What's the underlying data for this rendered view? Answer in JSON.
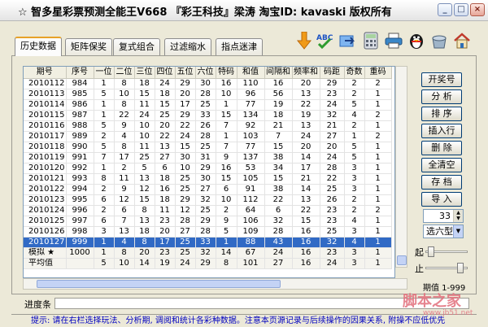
{
  "window": {
    "title": "☆ 智多星彩票预测全能王V668 『彩王科技』梁涛 淘宝ID: kavaski 版权所有",
    "controls": {
      "minimize": "_",
      "restore": "□",
      "close": "×"
    }
  },
  "tabs": [
    {
      "label": "历史数据",
      "active": true
    },
    {
      "label": "矩阵保奖",
      "active": false
    },
    {
      "label": "复式组合",
      "active": false
    },
    {
      "label": "过滤缩水",
      "active": false
    },
    {
      "label": "指点迷津",
      "active": false
    }
  ],
  "toolbar_icons": [
    "download-arrow-icon",
    "spellcheck-abc-icon",
    "export-icon",
    "calculator-icon",
    "printer-icon",
    "qq-penguin-icon",
    "recycle-icon",
    "home-icon"
  ],
  "grid": {
    "columns": [
      "期号",
      "序号",
      "一位",
      "二位",
      "三位",
      "四位",
      "五位",
      "六位",
      "特码",
      "和值",
      "间隔和",
      "频率和",
      "码距",
      "奇数",
      "重码"
    ],
    "rows": [
      [
        "2010112",
        "984",
        "1",
        "8",
        "18",
        "24",
        "29",
        "30",
        "16",
        "110",
        "16",
        "20",
        "29",
        "2",
        "2"
      ],
      [
        "2010113",
        "985",
        "5",
        "10",
        "15",
        "18",
        "20",
        "28",
        "10",
        "96",
        "56",
        "13",
        "23",
        "2",
        "1"
      ],
      [
        "2010114",
        "986",
        "1",
        "8",
        "11",
        "15",
        "17",
        "25",
        "1",
        "77",
        "19",
        "22",
        "24",
        "5",
        "1"
      ],
      [
        "2010115",
        "987",
        "1",
        "22",
        "24",
        "25",
        "29",
        "33",
        "15",
        "134",
        "18",
        "19",
        "32",
        "4",
        "2"
      ],
      [
        "2010116",
        "988",
        "5",
        "9",
        "10",
        "20",
        "22",
        "26",
        "7",
        "92",
        "21",
        "13",
        "21",
        "2",
        "1"
      ],
      [
        "2010117",
        "989",
        "2",
        "4",
        "10",
        "22",
        "24",
        "28",
        "1",
        "103",
        "7",
        "24",
        "27",
        "1",
        "2"
      ],
      [
        "2010118",
        "990",
        "5",
        "8",
        "11",
        "13",
        "15",
        "25",
        "7",
        "77",
        "15",
        "20",
        "20",
        "5",
        "1"
      ],
      [
        "2010119",
        "991",
        "7",
        "17",
        "25",
        "27",
        "30",
        "31",
        "9",
        "137",
        "38",
        "14",
        "24",
        "5",
        "1"
      ],
      [
        "2010120",
        "992",
        "1",
        "2",
        "5",
        "6",
        "10",
        "29",
        "16",
        "53",
        "34",
        "17",
        "28",
        "3",
        "1"
      ],
      [
        "2010121",
        "993",
        "8",
        "11",
        "13",
        "18",
        "25",
        "30",
        "15",
        "105",
        "15",
        "21",
        "22",
        "3",
        "1"
      ],
      [
        "2010122",
        "994",
        "2",
        "9",
        "12",
        "16",
        "25",
        "27",
        "6",
        "91",
        "38",
        "14",
        "25",
        "3",
        "1"
      ],
      [
        "2010123",
        "995",
        "6",
        "12",
        "15",
        "18",
        "29",
        "32",
        "10",
        "112",
        "22",
        "13",
        "26",
        "2",
        "1"
      ],
      [
        "2010124",
        "996",
        "2",
        "6",
        "8",
        "11",
        "12",
        "25",
        "2",
        "64",
        "6",
        "22",
        "23",
        "2",
        "2"
      ],
      [
        "2010125",
        "997",
        "6",
        "7",
        "13",
        "23",
        "28",
        "29",
        "9",
        "106",
        "32",
        "15",
        "23",
        "4",
        "1"
      ],
      [
        "2010126",
        "998",
        "3",
        "13",
        "18",
        "20",
        "27",
        "28",
        "5",
        "109",
        "28",
        "16",
        "25",
        "3",
        "1"
      ],
      [
        "2010127",
        "999",
        "1",
        "4",
        "8",
        "17",
        "25",
        "33",
        "1",
        "88",
        "43",
        "16",
        "32",
        "4",
        "1"
      ]
    ],
    "selected_row": 15,
    "summary_rows": [
      [
        "模拟 ★",
        "1000",
        "1",
        "8",
        "20",
        "23",
        "25",
        "32",
        "14",
        "67",
        "24",
        "16",
        "23",
        "3",
        "1"
      ],
      [
        "平均值",
        "",
        "5",
        "10",
        "14",
        "19",
        "24",
        "29",
        "8",
        "101",
        "27",
        "16",
        "24",
        "3",
        "1"
      ]
    ]
  },
  "side_buttons": [
    "开奖号",
    "分 析",
    "排 序",
    "插入行",
    "删 除",
    "全清空",
    "存 档",
    "导 入"
  ],
  "count_spinner": {
    "value": "33"
  },
  "select_mode": {
    "value": "选六型"
  },
  "slider_from_label": "起",
  "slider_to_label": "止",
  "period_range": "期值 1-999",
  "progress_label": "进度条",
  "progress_fraction": 0,
  "hint_text": "提示: 请在右栏选择玩法、分析期, 调阅和统计各彩种数据。注意本页源记录与后续操作的因果关系, 附操不应低优先",
  "watermark": {
    "text": "脚本之家",
    "url": "www.jb51.net"
  },
  "colors": {
    "selection": "#316ac5",
    "tab_accent": "#e7a229",
    "hint_text": "#0000c0",
    "watermark": "#e26f7c"
  }
}
